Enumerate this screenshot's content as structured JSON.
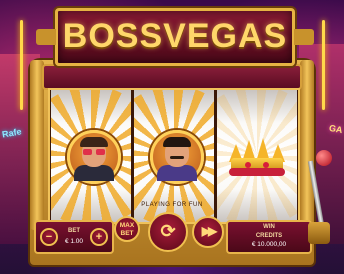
{
  "game": {
    "title": "BOSSVEGAS",
    "status_text": "PLAYING FOR FUN"
  },
  "signs": {
    "left": "Rafe",
    "right": "GA"
  },
  "reels": [
    {
      "symbol": "boss-with-red-glasses",
      "name": "boss-red-glasses-symbol"
    },
    {
      "symbol": "boss-with-mustache",
      "name": "boss-mustache-symbol"
    },
    {
      "symbol": "crown",
      "name": "crown-symbol"
    }
  ],
  "controls": {
    "bet_label": "BET",
    "bet_value": "€ 1.00",
    "minus_label": "−",
    "plus_label": "+",
    "max_bet_label": "MAX BET",
    "spin_icon": "spin-icon",
    "fast_icon": "fast-forward-icon",
    "win_label": "WIN",
    "credits_label": "CREDITS",
    "credits_value": "€ 10.000,00"
  },
  "colors": {
    "gold": "#e8b44a",
    "burgundy": "#7a1030",
    "title_gold": "#ffd76a"
  }
}
